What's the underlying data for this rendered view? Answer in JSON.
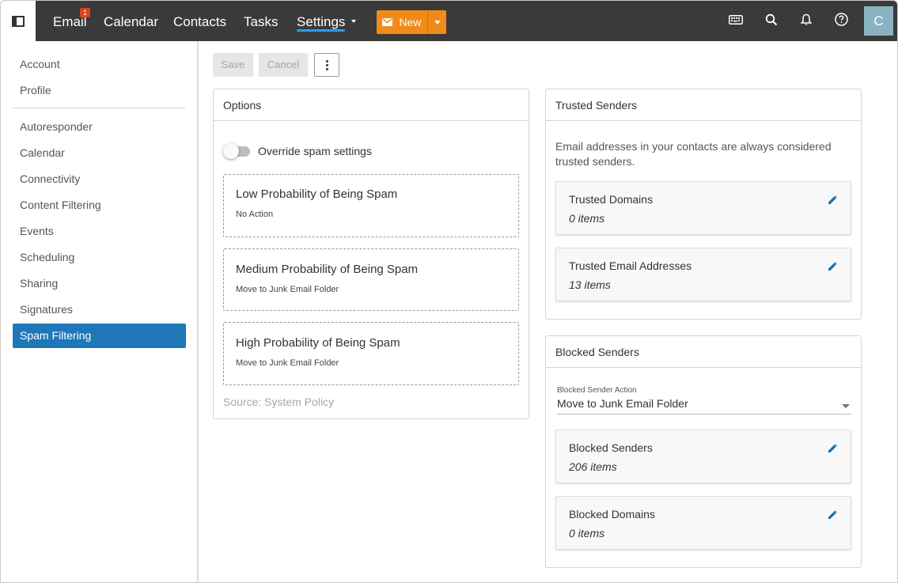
{
  "topbar": {
    "nav": [
      {
        "label": "Email",
        "badge": "1"
      },
      {
        "label": "Calendar"
      },
      {
        "label": "Contacts"
      },
      {
        "label": "Tasks"
      },
      {
        "label": "Settings"
      }
    ],
    "new_label": "New",
    "avatar_initial": "C",
    "colors": {
      "bar": "#3a3a3a",
      "new_button": "#f28a17",
      "badge": "#e2401c",
      "avatar": "#8bb4c2",
      "active_underline": "#2a9fe8"
    },
    "icons": [
      "sidebar-toggle-icon",
      "mail-icon",
      "keyboard-icon",
      "search-icon",
      "bell-icon",
      "help-icon"
    ]
  },
  "sidebar": {
    "items": [
      {
        "label": "Account"
      },
      {
        "label": "Profile"
      },
      {
        "label": "Autoresponder"
      },
      {
        "label": "Calendar"
      },
      {
        "label": "Connectivity"
      },
      {
        "label": "Content Filtering"
      },
      {
        "label": "Events"
      },
      {
        "label": "Scheduling"
      },
      {
        "label": "Sharing"
      },
      {
        "label": "Signatures"
      },
      {
        "label": "Spam Filtering",
        "active": true
      }
    ],
    "active_color": "#1e78b8"
  },
  "toolbar": {
    "save_label": "Save",
    "cancel_label": "Cancel"
  },
  "options": {
    "title": "Options",
    "toggle_label": "Override spam settings",
    "toggle_on": false,
    "levels": [
      {
        "title": "Low Probability of Being Spam",
        "action": "No Action"
      },
      {
        "title": "Medium Probability of Being Spam",
        "action": "Move to Junk Email Folder"
      },
      {
        "title": "High Probability of Being Spam",
        "action": "Move to Junk Email Folder"
      }
    ],
    "source": "Source: System Policy"
  },
  "trusted": {
    "title": "Trusted Senders",
    "description": "Email addresses in your contacts are always considered trusted senders.",
    "lists": [
      {
        "title": "Trusted Domains",
        "count": "0 items"
      },
      {
        "title": "Trusted Email Addresses",
        "count": "13 items"
      }
    ]
  },
  "blocked": {
    "title": "Blocked Senders",
    "action_label": "Blocked Sender Action",
    "action_value": "Move to Junk Email Folder",
    "lists": [
      {
        "title": "Blocked Senders",
        "count": "206 items"
      },
      {
        "title": "Blocked Domains",
        "count": "0 items"
      }
    ]
  }
}
